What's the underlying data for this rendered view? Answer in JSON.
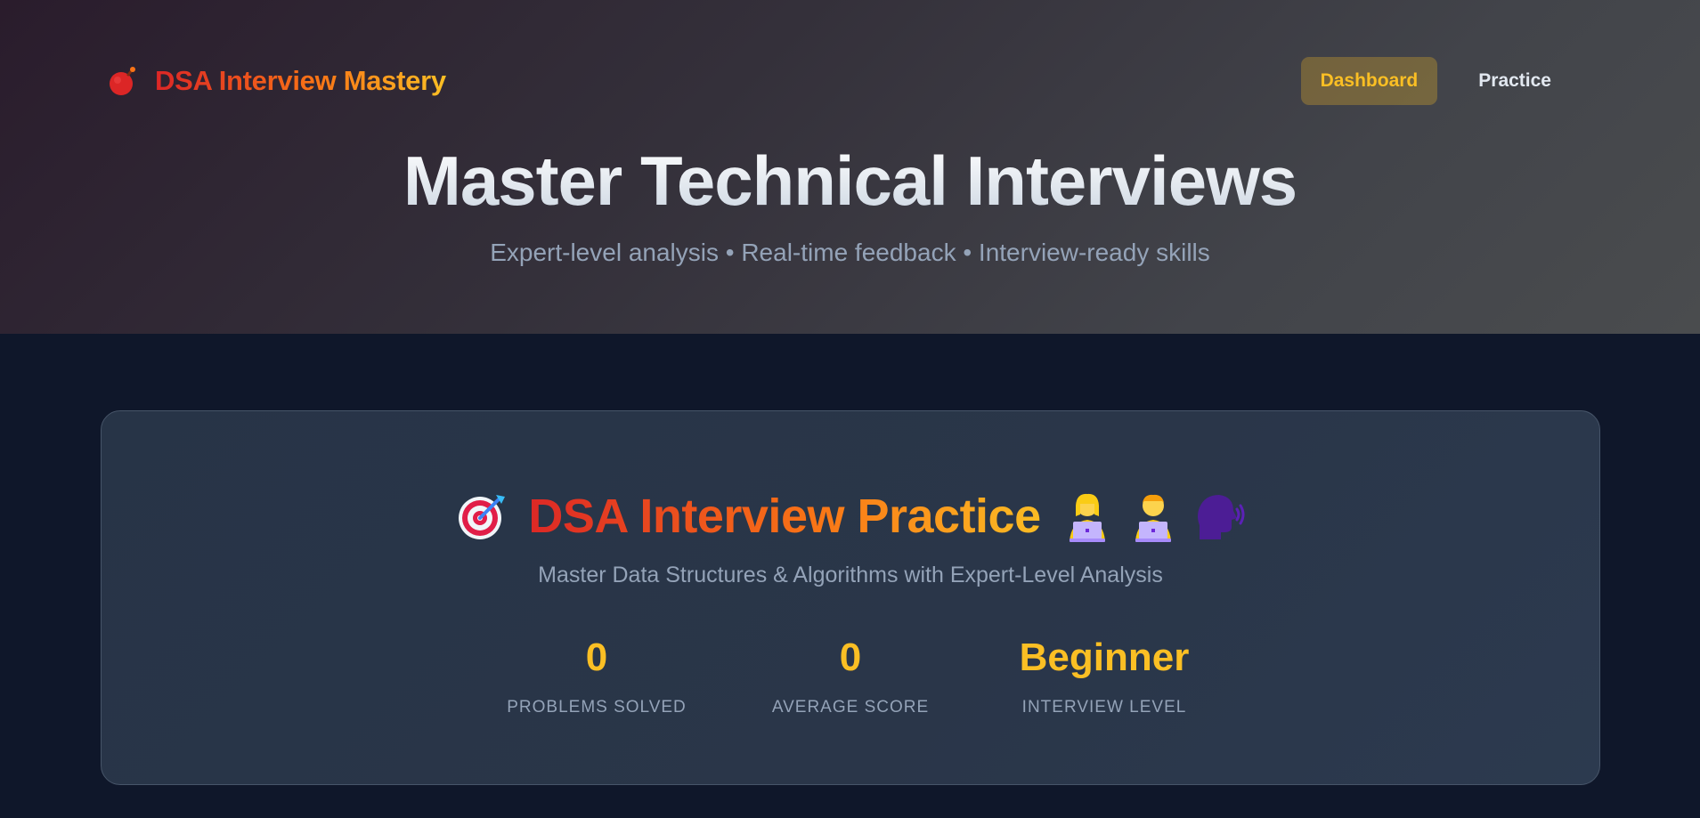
{
  "header": {
    "brand_icon": "fire-bomb-icon",
    "brand_title": "DSA Interview Mastery",
    "nav": [
      {
        "label": "Dashboard",
        "active": true
      },
      {
        "label": "Practice",
        "active": false
      }
    ]
  },
  "hero": {
    "title": "Master Technical Interviews",
    "subtitle": "Expert-level analysis • Real-time feedback • Interview-ready skills"
  },
  "card": {
    "title": "DSA Interview Practice",
    "title_icons": [
      "target-icon",
      "woman-technologist-icon",
      "man-technologist-icon",
      "speaking-head-icon"
    ],
    "subtitle": "Master Data Structures & Algorithms with Expert-Level Analysis",
    "stats": [
      {
        "value": "0",
        "label": "PROBLEMS SOLVED"
      },
      {
        "value": "0",
        "label": "AVERAGE SCORE"
      },
      {
        "value": "Beginner",
        "label": "INTERVIEW LEVEL"
      }
    ]
  },
  "colors": {
    "accent_red": "#dc2626",
    "accent_orange": "#f97316",
    "accent_yellow": "#fbbf24",
    "background": "#0f172a"
  }
}
